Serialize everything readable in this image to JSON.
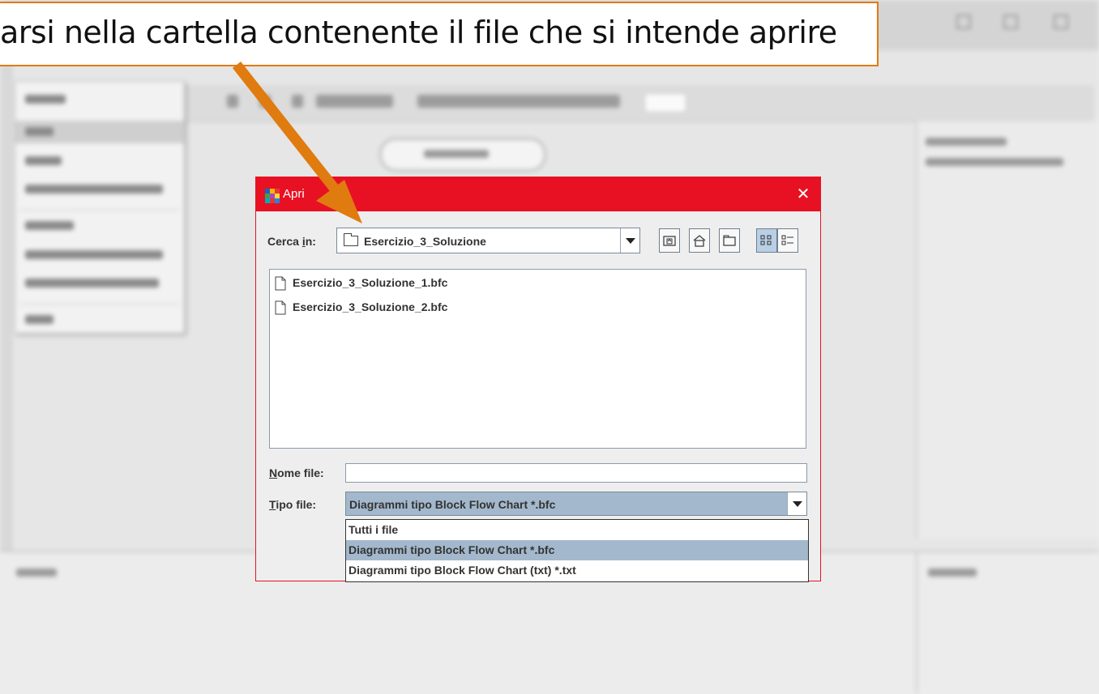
{
  "callout": {
    "text": "arsi nella cartella contenente il file che si intende aprire",
    "color": "#e07b10"
  },
  "dialog": {
    "title": "Apri",
    "title_bar_color": "#e81123",
    "close_icon": "close-icon",
    "look_in": {
      "label_pre": "Cerca ",
      "label_mnemonic": "i",
      "label_post": "n:",
      "value": "Esercizio_3_Soluzione"
    },
    "toolbar_icons": [
      "up-one-level-icon",
      "home-icon",
      "new-folder-icon",
      "list-view-icon",
      "details-view-icon"
    ],
    "files": [
      {
        "name": "Esercizio_3_Soluzione_1.bfc"
      },
      {
        "name": "Esercizio_3_Soluzione_2.bfc"
      }
    ],
    "file_name": {
      "label_mnemonic": "N",
      "label_post": "ome file:",
      "value": ""
    },
    "file_type": {
      "label_mnemonic": "T",
      "label_post": "ipo file:",
      "selected": "Diagrammi tipo Block Flow Chart *.bfc",
      "options": [
        "Tutti i file",
        "Diagrammi tipo Block Flow Chart *.bfc",
        "Diagrammi tipo Block Flow Chart (txt) *.txt"
      ],
      "highlighted_index": 1,
      "highlight_color": "#a3b8cc"
    }
  }
}
